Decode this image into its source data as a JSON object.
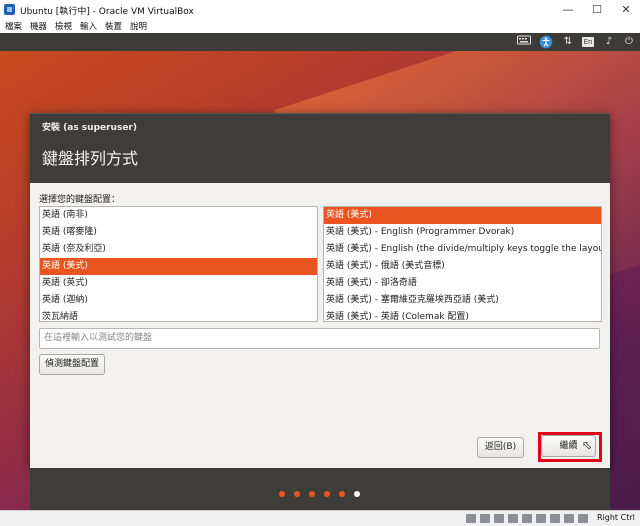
{
  "vbox": {
    "title": "Ubuntu [執行中] - Oracle VM VirtualBox",
    "menu": [
      "檔案",
      "機器",
      "檢視",
      "輸入",
      "裝置",
      "說明"
    ],
    "hostkey": "Right Ctrl"
  },
  "panel": {
    "lang_badge": "En"
  },
  "installer": {
    "window_title": "安裝 (as superuser)",
    "heading": "鍵盤排列方式",
    "prompt": "選擇您的鍵盤配置：",
    "layouts": [
      "英語 (南非)",
      "英語 (喀麥隆)",
      "英語 (奈及利亞)",
      "英語 (美式)",
      "英語 (英式)",
      "英語 (迦納)",
      "茨瓦納語"
    ],
    "variants": [
      "英語 (美式)",
      "英語 (美式) - English (Programmer Dvorak)",
      "英語 (美式) - English (the divide/multiply keys toggle the layout)",
      "英語 (美式) - 俄語 (美式音標)",
      "英語 (美式) - 卻洛奇語",
      "英語 (美式) - 塞爾維亞克羅埃西亞語 (美式)",
      "英語 (美式) - 英語 (Colemak 配置)"
    ],
    "test_placeholder": "在這裡輸入以測試您的鍵盤",
    "detect_button": "偵測鍵盤配置",
    "back_button": "返回(B)",
    "continue_button": "繼續",
    "progress": {
      "total": 6,
      "current": 6
    }
  }
}
